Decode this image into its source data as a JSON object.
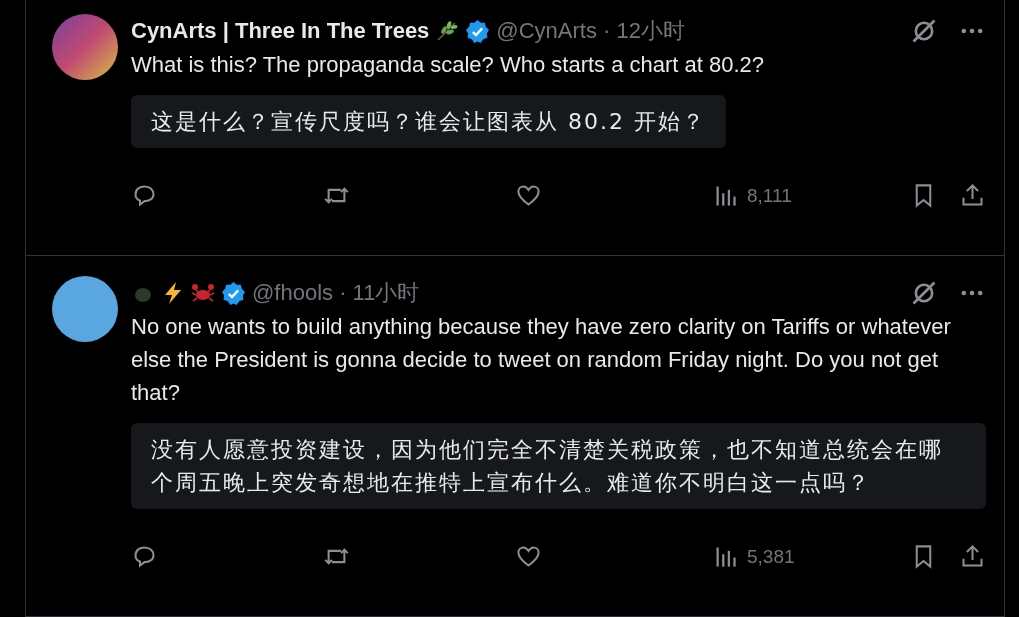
{
  "tweets": [
    {
      "kind": "plant",
      "display_name": "CynArts | Three In The Trees",
      "verified": true,
      "handle_time": "@CynArts · 12小时",
      "text": "What is this? The propaganda scale? Who starts a chart at 80.2?",
      "translation": "这是什么？宣传尺度吗？谁会让图表从 80.2 开始？",
      "views": "8,111"
    },
    {
      "kind": "crab",
      "verified": true,
      "handle_time": "@fhools · 11小时",
      "text": "No one wants to build anything because they have zero clarity on Tariffs or whatever else the President is gonna decide to tweet on random Friday night. Do you not get that?",
      "translation": "没有人愿意投资建设，因为他们完全不清楚关税政策，也不知道总统会在哪个周五晚上突发奇想地在推特上宣布什么。难道你不明白这一点吗？",
      "views": "5,381"
    }
  ]
}
